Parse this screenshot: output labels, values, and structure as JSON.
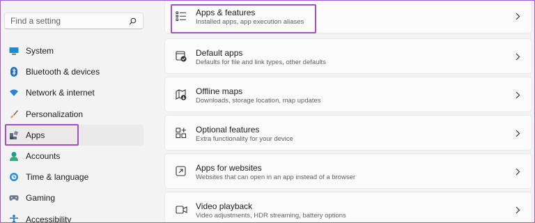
{
  "search": {
    "placeholder": "Find a setting"
  },
  "sidebar": {
    "items": [
      {
        "label": "System",
        "icon": "monitor-icon"
      },
      {
        "label": "Bluetooth & devices",
        "icon": "bluetooth-icon"
      },
      {
        "label": "Network & internet",
        "icon": "wifi-icon"
      },
      {
        "label": "Personalization",
        "icon": "brush-icon"
      },
      {
        "label": "Apps",
        "icon": "apps-icon",
        "selected": true
      },
      {
        "label": "Accounts",
        "icon": "person-icon"
      },
      {
        "label": "Time & language",
        "icon": "globe-clock-icon"
      },
      {
        "label": "Gaming",
        "icon": "controller-icon"
      },
      {
        "label": "Accessibility",
        "icon": "accessibility-icon"
      }
    ]
  },
  "main": {
    "cards": [
      {
        "title": "Apps & features",
        "description": "Installed apps, app execution aliases",
        "icon": "list-icon",
        "highlighted": true
      },
      {
        "title": "Default apps",
        "description": "Defaults for file and link types, other defaults",
        "icon": "default-apps-icon"
      },
      {
        "title": "Offline maps",
        "description": "Downloads, storage location, map updates",
        "icon": "map-download-icon"
      },
      {
        "title": "Optional features",
        "description": "Extra functionality for your device",
        "icon": "grid-add-icon"
      },
      {
        "title": "Apps for websites",
        "description": "Websites that can open in an app instead of a browser",
        "icon": "open-in-app-icon"
      },
      {
        "title": "Video playback",
        "description": "Video adjustments, HDR streaming, battery options",
        "icon": "video-icon"
      }
    ]
  },
  "colors": {
    "highlight": "#a64fc5",
    "accent": "#0067c0"
  }
}
